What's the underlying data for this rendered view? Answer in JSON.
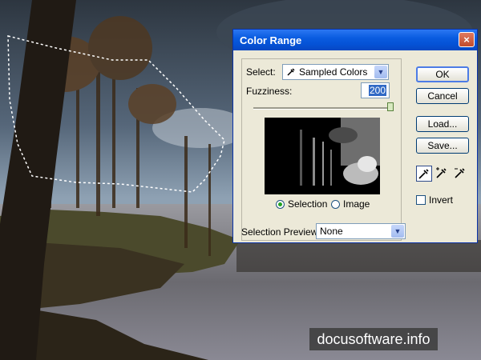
{
  "dialog": {
    "title": "Color Range",
    "close_label": "×",
    "select_label": "Select:",
    "select_value": "Sampled Colors",
    "fuzziness_label": "Fuzziness:",
    "fuzziness_value": "200",
    "fuzziness_fraction": 1.0,
    "radio_selection": "Selection",
    "radio_image": "Image",
    "selected_radio": "Selection",
    "preview_label": "Selection Preview:",
    "preview_value": "None",
    "buttons": {
      "ok": "OK",
      "cancel": "Cancel",
      "load": "Load...",
      "save": "Save..."
    },
    "invert_label": "Invert",
    "invert_checked": false,
    "eyedroppers": [
      "eyedropper-icon",
      "eyedropper-plus-icon",
      "eyedropper-minus-icon"
    ]
  },
  "watermark": "docusoftware.info",
  "colors": {
    "dialog_bg": "#ece9d8",
    "titlebar": "#0a5ce0",
    "highlight": "#316ac5"
  }
}
